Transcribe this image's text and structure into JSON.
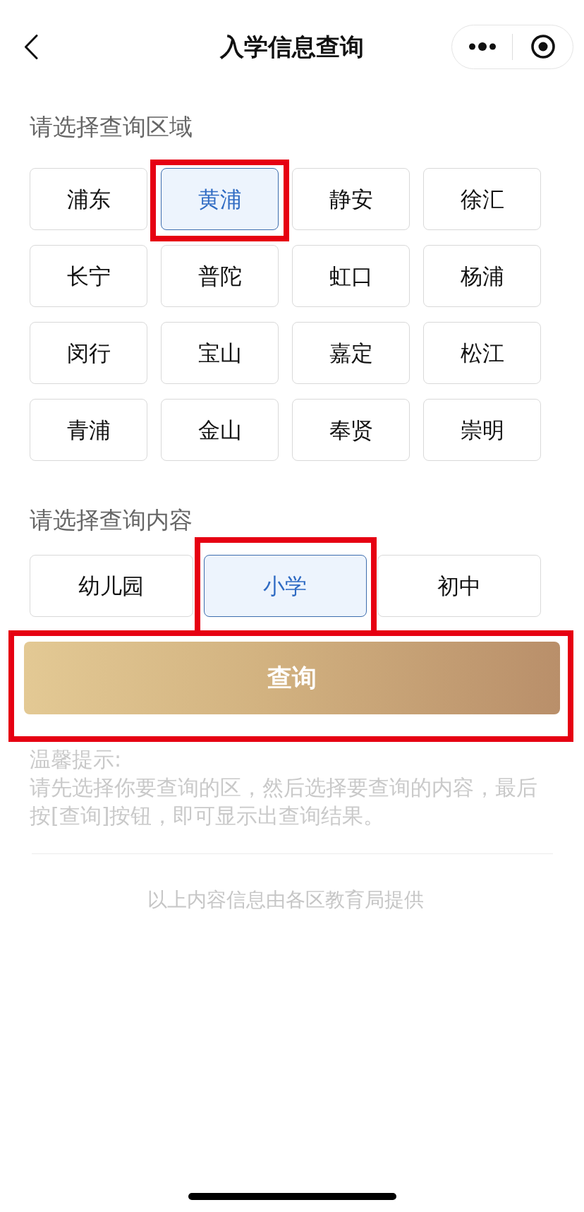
{
  "nav": {
    "title": "入学信息查询"
  },
  "region_section": {
    "label": "请选择查询区域",
    "districts": [
      {
        "label": "浦东",
        "selected": false,
        "highlighted": false
      },
      {
        "label": "黄浦",
        "selected": true,
        "highlighted": true
      },
      {
        "label": "静安",
        "selected": false,
        "highlighted": false
      },
      {
        "label": "徐汇",
        "selected": false,
        "highlighted": false
      },
      {
        "label": "长宁",
        "selected": false,
        "highlighted": false
      },
      {
        "label": "普陀",
        "selected": false,
        "highlighted": false
      },
      {
        "label": "虹口",
        "selected": false,
        "highlighted": false
      },
      {
        "label": "杨浦",
        "selected": false,
        "highlighted": false
      },
      {
        "label": "闵行",
        "selected": false,
        "highlighted": false
      },
      {
        "label": "宝山",
        "selected": false,
        "highlighted": false
      },
      {
        "label": "嘉定",
        "selected": false,
        "highlighted": false
      },
      {
        "label": "松江",
        "selected": false,
        "highlighted": false
      },
      {
        "label": "青浦",
        "selected": false,
        "highlighted": false
      },
      {
        "label": "金山",
        "selected": false,
        "highlighted": false
      },
      {
        "label": "奉贤",
        "selected": false,
        "highlighted": false
      },
      {
        "label": "崇明",
        "selected": false,
        "highlighted": false
      }
    ]
  },
  "content_section": {
    "label": "请选择查询内容",
    "levels": [
      {
        "label": "幼儿园",
        "selected": false,
        "highlighted": false
      },
      {
        "label": "小学",
        "selected": true,
        "highlighted": true
      },
      {
        "label": "初中",
        "selected": false,
        "highlighted": false
      }
    ]
  },
  "query_button": {
    "label": "查询",
    "highlighted": true
  },
  "hint": {
    "title": "温馨提示:",
    "text": "请先选择你要查询的区，然后选择要查询的内容，最后按[查询]按钮，即可显示出查询结果。"
  },
  "footer": "以上内容信息由各区教育局提供"
}
